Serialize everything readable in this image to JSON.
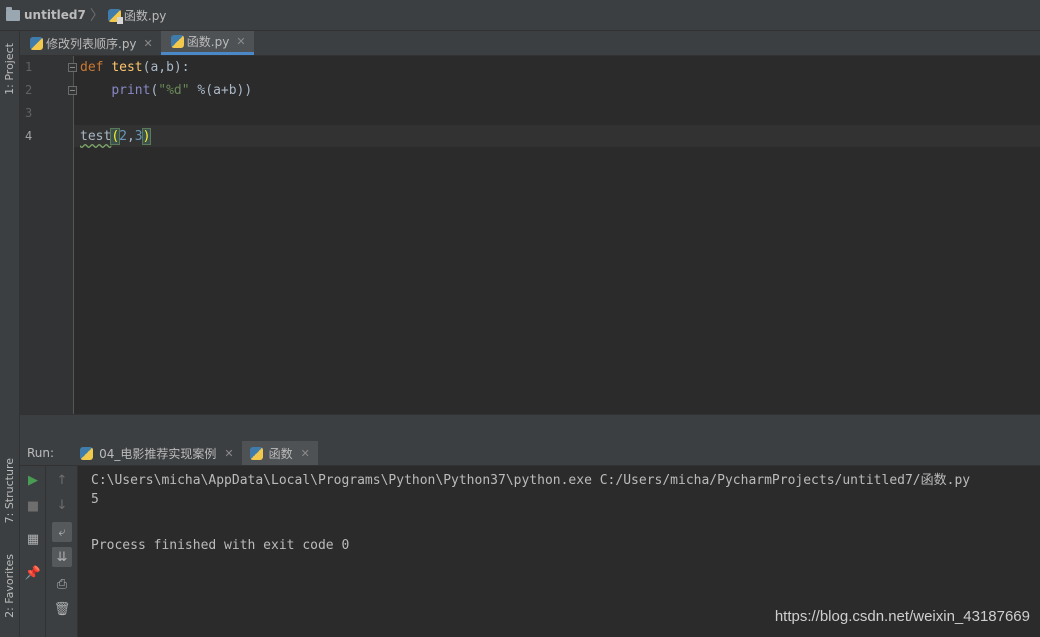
{
  "breadcrumb": {
    "project": "untitled7",
    "file": "函数.py"
  },
  "left_strip": {
    "project_tab": "1: Project",
    "structure_tab": "7: Structure",
    "favorites_tab": "2: Favorites"
  },
  "editor_tabs": [
    {
      "label": "修改列表顺序.py",
      "active": false
    },
    {
      "label": "函数.py",
      "active": true
    }
  ],
  "editor": {
    "line_numbers": [
      "1",
      "2",
      "3",
      "4"
    ],
    "lines": {
      "l1": {
        "kw": "def",
        "fn": "test",
        "args": "(a,b):"
      },
      "l2": {
        "indent": "    ",
        "builtin": "print",
        "open": "(",
        "str": "\"%d\"",
        "mod": " %",
        "expr": "(a+b))"
      },
      "l4": {
        "fn": "test",
        "open": "(",
        "arg1": "2",
        "comma": ",",
        "arg2": "3",
        "close": ")"
      }
    }
  },
  "run_panel": {
    "label": "Run:",
    "tabs": [
      {
        "label": "04_电影推荐实现案例",
        "active": false
      },
      {
        "label": "函数",
        "active": true
      }
    ],
    "console": [
      "C:\\Users\\micha\\AppData\\Local\\Programs\\Python\\Python37\\python.exe C:/Users/micha/PycharmProjects/untitled7/函数.py",
      "5",
      "",
      "Process finished with exit code 0"
    ]
  },
  "watermark": "https://blog.csdn.net/weixin_43187669",
  "colors": {
    "keyword": "#cc7832",
    "function": "#ffc66d",
    "string": "#6a8759",
    "number": "#6897bb",
    "run_green": "#499c54",
    "accent": "#4a88c7"
  }
}
